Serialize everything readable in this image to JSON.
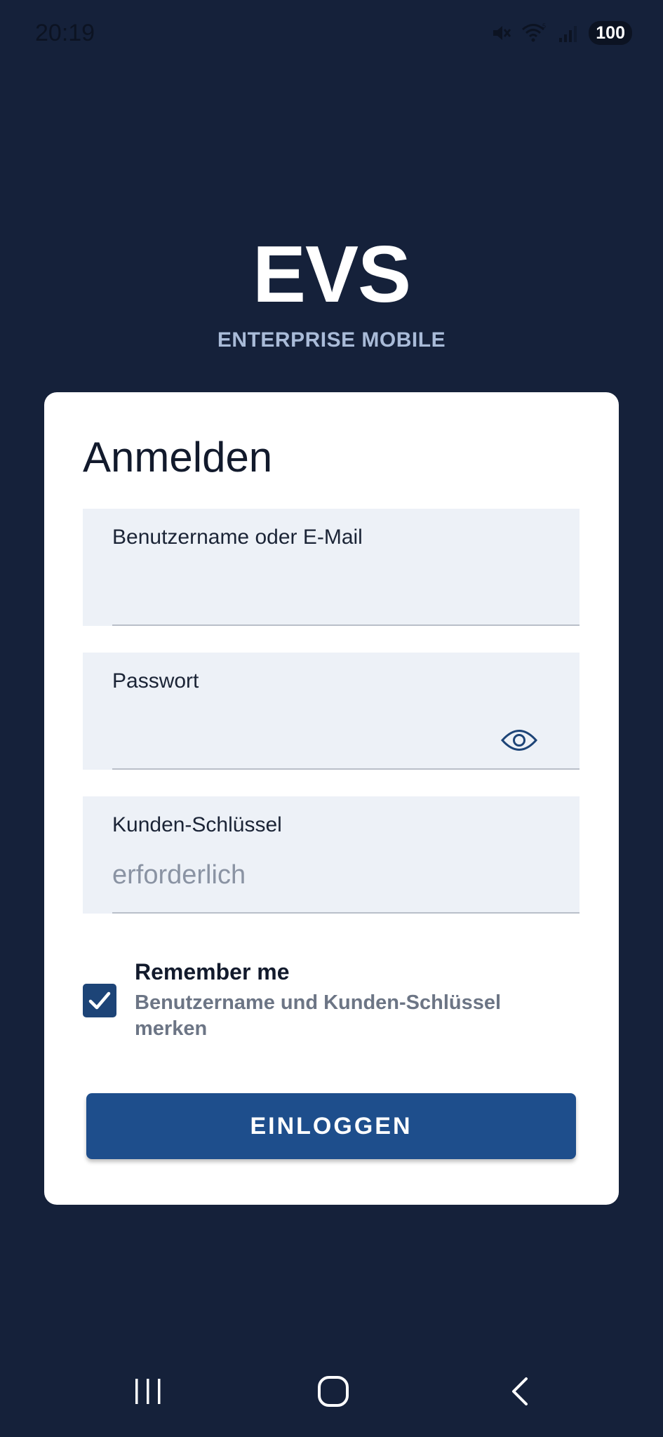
{
  "status_bar": {
    "time": "20:19",
    "battery": "100",
    "icons": [
      "mute-icon",
      "wifi-icon",
      "signal-icon",
      "battery-icon"
    ]
  },
  "brand": {
    "logo": "EVS",
    "subtitle": "ENTERPRISE MOBILE"
  },
  "login": {
    "title": "Anmelden",
    "username": {
      "label": "Benutzername oder E-Mail",
      "value": "",
      "placeholder": ""
    },
    "password": {
      "label": "Passwort",
      "value": "",
      "placeholder": ""
    },
    "customer_key": {
      "label": "Kunden-Schlüssel",
      "value": "",
      "placeholder": "erforderlich"
    },
    "remember": {
      "checked": true,
      "title": "Remember me",
      "description": "Benutzername und Kunden-Schlüssel merken"
    },
    "submit_label": "EINLOGGEN"
  },
  "nav_bar": {
    "buttons": [
      "recent-apps-icon",
      "home-icon",
      "back-icon"
    ]
  },
  "colors": {
    "background": "#15213a",
    "card": "#ffffff",
    "field": "#edf1f7",
    "accent": "#1e4e8c",
    "checkbox": "#1d4477",
    "subtitle": "#a9bbd8"
  }
}
